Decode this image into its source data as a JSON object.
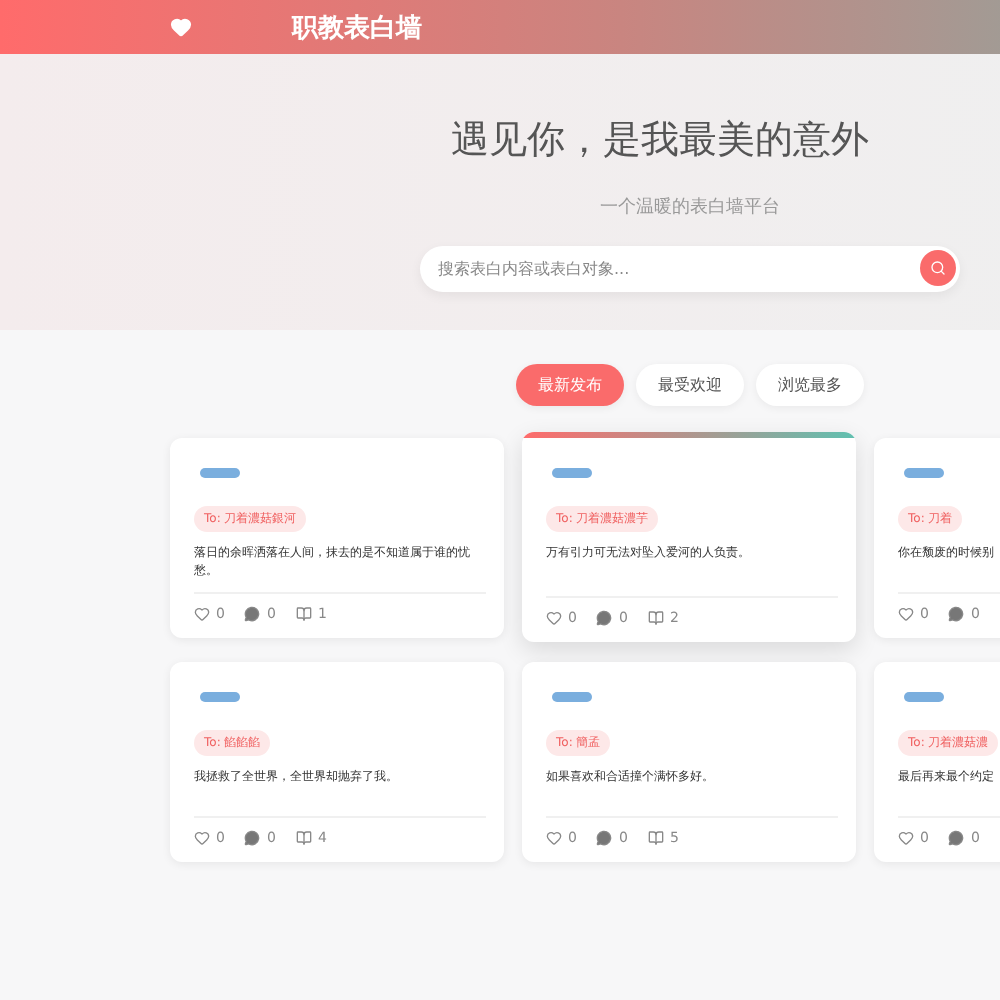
{
  "header": {
    "title": "职教表白墙"
  },
  "hero": {
    "title": "遇见你，是我最美的意外",
    "subtitle": "一个温暖的表白墙平台",
    "search": {
      "placeholder": "搜索表白内容或表白对象..."
    }
  },
  "tabs": [
    {
      "label": "最新发布",
      "selected": true
    },
    {
      "label": "最受欢迎",
      "selected": false
    },
    {
      "label": "浏览最多",
      "selected": false
    }
  ],
  "posts": [
    {
      "to": "To: 刀着濃菇銀河",
      "text": "落日的余晖洒落在人间，抹去的是不知道属于谁的忧愁。",
      "likes": "0",
      "comments": "0",
      "views": "1",
      "highlighted": false
    },
    {
      "to": "To: 刀着濃菇濃芋",
      "text": "万有引力可无法对坠入爱河的人负责。",
      "likes": "0",
      "comments": "0",
      "views": "2",
      "highlighted": true
    },
    {
      "to": "To: 刀着",
      "text": "你在颓废的时候别",
      "likes": "0",
      "comments": "0",
      "highlighted": false
    },
    {
      "to": "To: 餡餡餡",
      "text": "我拯救了全世界，全世界却抛弃了我。",
      "likes": "0",
      "comments": "0",
      "views": "4",
      "highlighted": false
    },
    {
      "to": "To: 簡孟",
      "text": "如果喜欢和合适撞个满怀多好。",
      "likes": "0",
      "comments": "0",
      "views": "5",
      "highlighted": false
    },
    {
      "to": "To: 刀着濃菇濃",
      "text": "最后再来最个约定",
      "likes": "0",
      "comments": "0",
      "highlighted": false
    }
  ]
}
